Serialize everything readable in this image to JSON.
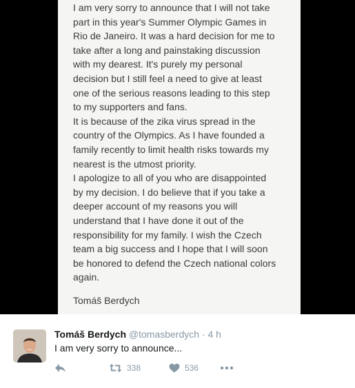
{
  "note": {
    "lines": [
      "I am very sorry to announce that I will not take",
      "part in this year's Summer Olympic Games in",
      "Rio de Janeiro. It was a hard decision for me to",
      "take after a long and painstaking discussion",
      "with my dearest. It's purely my personal",
      "decision but I still feel a need to give at least",
      "one of the serious reasons leading to this step",
      "to my supporters and fans.",
      "It is because of the zika virus spread in the",
      "country of the Olympics. As I have founded a",
      "family recently to limit health risks towards my",
      "nearest is the utmost priority.",
      "I apologize to all of you who are disappointed",
      "by my decision. I do believe that if you take a",
      "deeper account of my reasons you will",
      "understand that I have done it out of the",
      "responsibility for my family. I wish the Czech",
      "team a big success and I hope that I will soon",
      "be honored to defend the Czech national colors",
      "again."
    ],
    "signature": "Tomáš Berdych"
  },
  "tweet": {
    "author_name": "Tomáš Berdych",
    "handle": "@tomasberdych",
    "separator": "·",
    "time": "4 h",
    "text": "I am very sorry to announce...",
    "retweet_count": "338",
    "like_count": "536"
  },
  "icons": {
    "reply": "reply-icon",
    "retweet": "retweet-icon",
    "like": "heart-icon",
    "more": "more-icon",
    "avatar": "avatar"
  },
  "colors": {
    "media_background": "#000000",
    "note_background": "#f5f5f3",
    "note_text": "#3a3a3a",
    "name_text": "#14171a",
    "meta_text": "#8899a6"
  }
}
